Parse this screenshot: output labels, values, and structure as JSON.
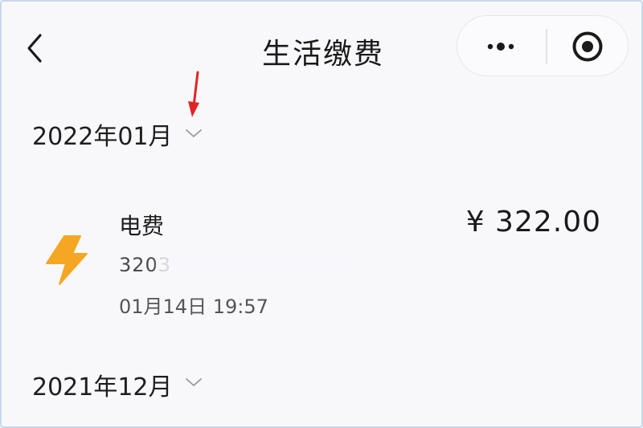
{
  "nav": {
    "title": "生活缴费",
    "back_icon": "chevron-left-icon",
    "more_icon": "more-dots-icon",
    "close_icon": "target-close-icon"
  },
  "annotation": {
    "color": "#e02424"
  },
  "months": [
    {
      "label": "2022年01月",
      "bills": [
        {
          "icon": "lightning-bolt-icon",
          "icon_color": "#f5a623",
          "name": "电费",
          "account": "3203",
          "datetime": "01月14日 19:57",
          "amount": "¥ 322.00"
        }
      ]
    },
    {
      "label": "2021年12月",
      "bills": []
    }
  ]
}
